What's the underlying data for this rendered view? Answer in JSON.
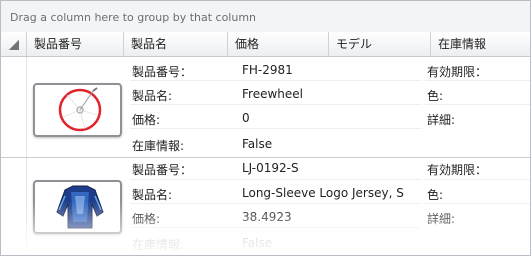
{
  "group_panel": {
    "hint": "Drag a column here to group by that column"
  },
  "columns": [
    {
      "label": "製品番号"
    },
    {
      "label": "製品名"
    },
    {
      "label": "価格"
    },
    {
      "label": "モデル"
    },
    {
      "label": "在庫情報"
    }
  ],
  "rows": [
    {
      "image_icon": "bicycle-wheel-icon",
      "fields": [
        {
          "label": "製品番号：",
          "value": "FH-2981"
        },
        {
          "label": "製品名:",
          "value": "Freewheel"
        },
        {
          "label": "価格:",
          "value": "0"
        },
        {
          "label": "在庫情報:",
          "value": "False"
        }
      ],
      "side_fields": [
        {
          "label": "有効期限："
        },
        {
          "label": "色:"
        },
        {
          "label": "詳細:"
        }
      ]
    },
    {
      "image_icon": "jersey-icon",
      "fields": [
        {
          "label": "製品番号：",
          "value": "LJ-0192-S"
        },
        {
          "label": "製品名:",
          "value": "Long-Sleeve Logo Jersey, S"
        },
        {
          "label": "価格:",
          "value": "38.4923"
        },
        {
          "label": "在庫情報:",
          "value": "False"
        }
      ],
      "side_fields": [
        {
          "label": "有効期限："
        },
        {
          "label": "色:"
        },
        {
          "label": "詳細:"
        }
      ]
    }
  ]
}
